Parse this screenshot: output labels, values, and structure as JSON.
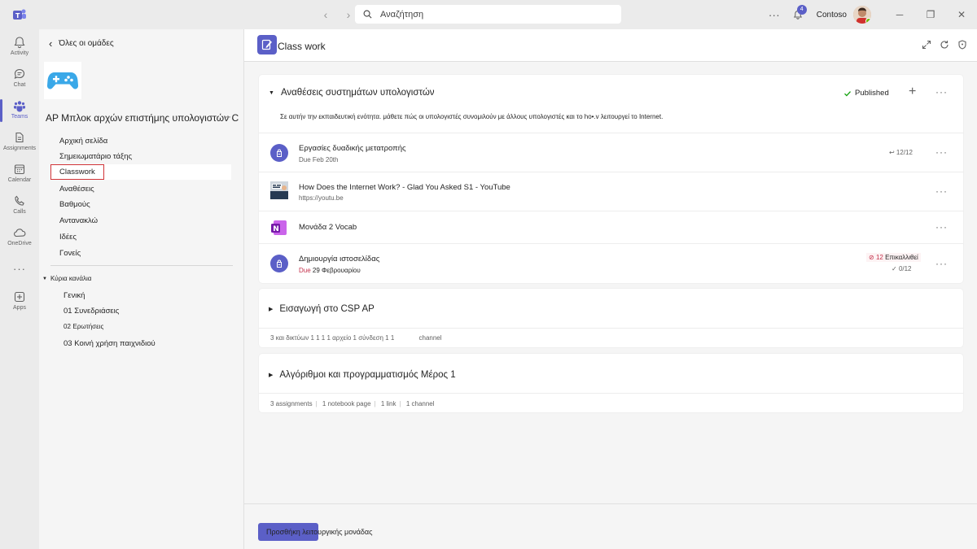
{
  "titlebar": {
    "search_placeholder": "Αναζήτηση",
    "notification_count": "4",
    "org_name": "Contoso"
  },
  "rail": {
    "items": [
      {
        "label": "Activity",
        "icon": "bell-icon"
      },
      {
        "label": "Chat",
        "icon": "chat-icon"
      },
      {
        "label": "Teams",
        "icon": "teams-icon"
      },
      {
        "label": "Assignments",
        "icon": "assignments-icon"
      },
      {
        "label": "Calendar",
        "icon": "calendar-icon"
      },
      {
        "label": "Calls",
        "icon": "phone-icon"
      },
      {
        "label": "OneDrive",
        "icon": "cloud-icon"
      },
      {
        "label": "Apps",
        "icon": "apps-icon"
      }
    ],
    "more": "···"
  },
  "team": {
    "back_label": "Όλες οι ομάδες",
    "name": "AP Μπλοκ αρχών επιστήμης υπολογιστών C",
    "nav": [
      "Αρχική σελίδα",
      "Σημειωματάριο τάξης",
      "Classwork",
      "Αναθέσεις",
      "Βαθμούς",
      "Αντανακλώ",
      "Ιδέες",
      "Γονείς"
    ],
    "channels_header": "Κύρια κανάλια",
    "channels": [
      {
        "num": "",
        "label": "Γενική"
      },
      {
        "num": "01",
        "label": "Συνεδριάσεις"
      },
      {
        "num": "02",
        "label": "Ερωτήσεις"
      },
      {
        "num": "03",
        "label": "Κοινή χρήση παιχνιδιού"
      }
    ]
  },
  "main": {
    "title": "Class work",
    "add_unit_label": "Προσθήκη λειτουργικής μονάδας",
    "units": [
      {
        "title": "Αναθέσεις συστημάτων υπολογιστών",
        "status": "Published",
        "description": "Σε αυτήν την εκπαιδευτική ενότητα. μάθετε πώς οι υπολογιστές συνομιλούν με άλλους υπολογιστές και το ho•.v λειτουργεί το Internet.",
        "items": [
          {
            "title": "Εργασίες δυαδικής μετατροπής",
            "sub": "Due Feb 20th",
            "meta": "↩ 12/12"
          },
          {
            "title": "How Does the Internet Work? - Glad You Asked S1 - YouTube",
            "sub": "https://youtu.be"
          },
          {
            "title": "Μονάδα 2 Vocab"
          },
          {
            "title": "Δημιουργία ιστοσελίδας",
            "due_label": "Due",
            "due_date": "29 Φεβρουαρίου",
            "overdue_count": "12",
            "overdue_label": "Επικαλλιθεί",
            "turned_in": "0/12"
          }
        ]
      },
      {
        "title": "Εισαγωγή στο CSP AP",
        "stats_a": "3",
        "stats_b": "και δικτύων 1 1 1 1 αρχείο 1 σύνδεση 1 1",
        "stats_c": "channel"
      },
      {
        "title": "Αλγόριθμοι και προγραμματισμός Μέρος 1",
        "stats": [
          "3 assignments",
          "1 notebook page",
          "1 link",
          "1 channel"
        ]
      }
    ]
  },
  "colors": {
    "brand": "#5b5fc7",
    "late": "#c4314b",
    "published_check": "#13a10e",
    "selection_outline": "#d13438"
  }
}
